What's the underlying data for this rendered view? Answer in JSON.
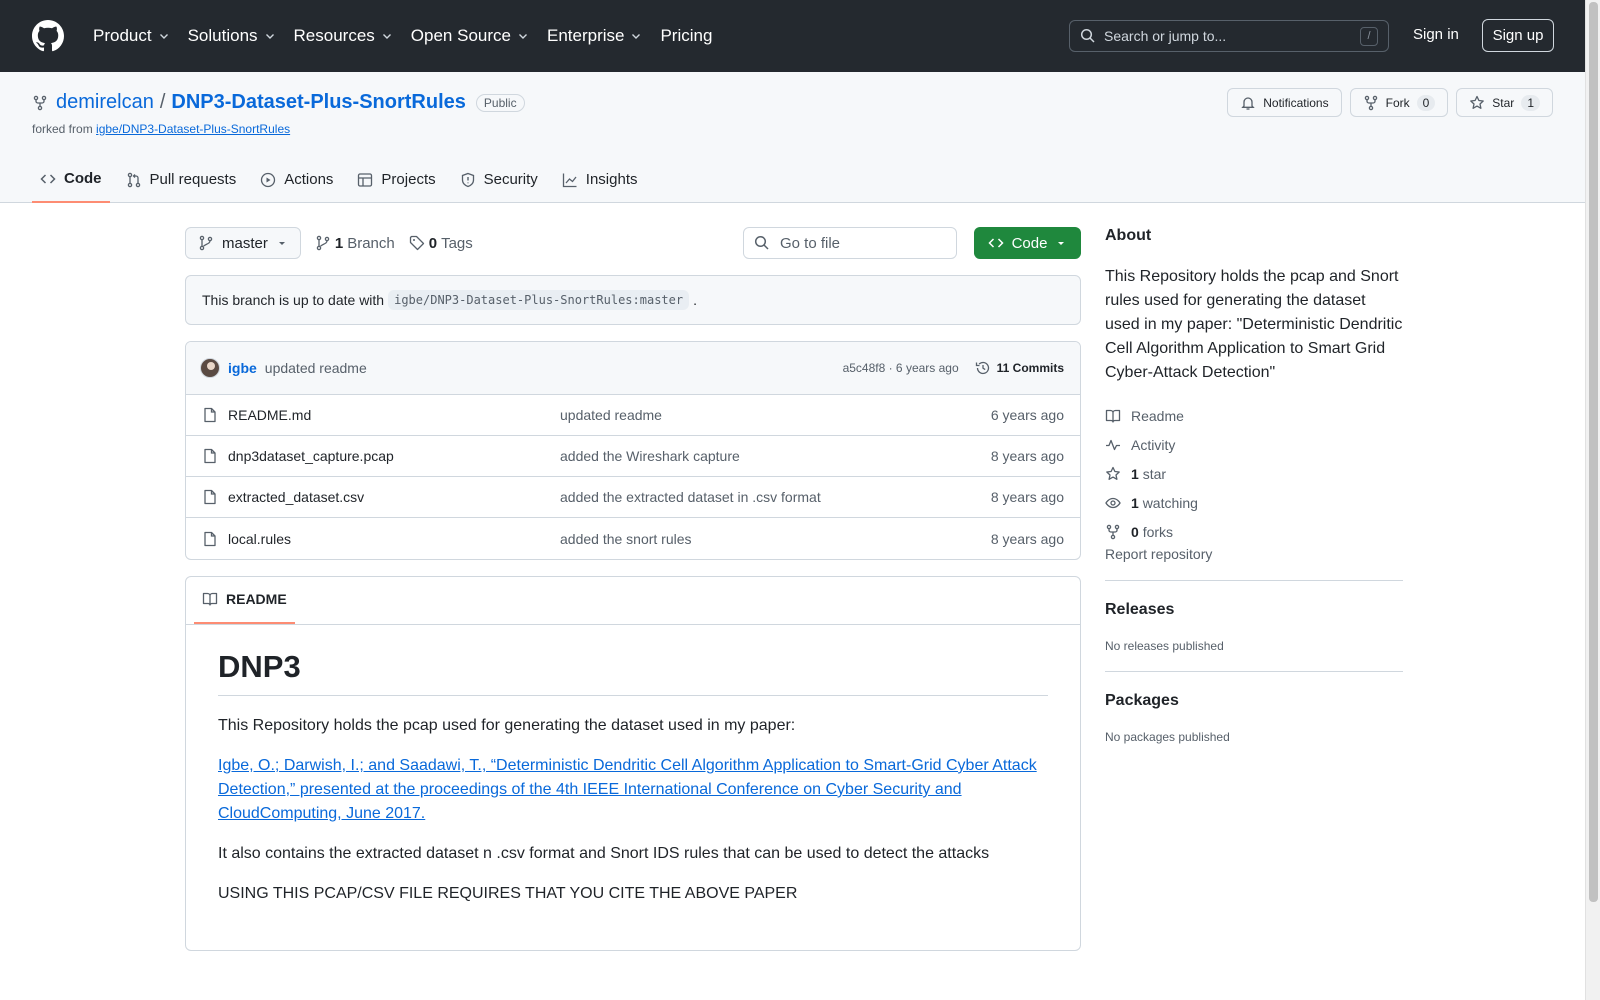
{
  "topnav": {
    "items": [
      "Product",
      "Solutions",
      "Resources",
      "Open Source",
      "Enterprise",
      "Pricing"
    ],
    "search_placeholder": "Search or jump to...",
    "search_shortcut": "/",
    "signin": "Sign in",
    "signup": "Sign up"
  },
  "repo": {
    "owner": "demirelcan",
    "separator": "/",
    "name": "DNP3-Dataset-Plus-SnortRules",
    "visibility": "Public",
    "forked_prefix": "forked from",
    "forked_from": "igbe/DNP3-Dataset-Plus-SnortRules",
    "notifications_label": "Notifications",
    "fork_label": "Fork",
    "fork_count": "0",
    "star_label": "Star",
    "star_count": "1"
  },
  "tabs": [
    "Code",
    "Pull requests",
    "Actions",
    "Projects",
    "Security",
    "Insights"
  ],
  "branchbar": {
    "branch": "master",
    "branch_count": "1",
    "branch_label": "Branch",
    "tag_count": "0",
    "tag_label": "Tags",
    "go_to_file": "Go to file",
    "code_button": "Code"
  },
  "uptodate": {
    "text": "This branch is up to date with",
    "ref": "igbe/DNP3-Dataset-Plus-SnortRules:master",
    "period": "."
  },
  "commit": {
    "author": "igbe",
    "message": "updated readme",
    "sha_age": "a5c48f8 · 6 years ago",
    "commits": "11 Commits"
  },
  "files": [
    {
      "name": "README.md",
      "message": "updated readme",
      "age": "6 years ago"
    },
    {
      "name": "dnp3dataset_capture.pcap",
      "message": "added the Wireshark capture",
      "age": "8 years ago"
    },
    {
      "name": "extracted_dataset.csv",
      "message": "added the extracted dataset in .csv format",
      "age": "8 years ago"
    },
    {
      "name": "local.rules",
      "message": "added the snort rules",
      "age": "8 years ago"
    }
  ],
  "readme": {
    "tab": "README",
    "heading": "DNP3",
    "p1": "This Repository holds the pcap used for generating the dataset used in my paper:",
    "citation": "Igbe, O.; Darwish, I.; and Saadawi, T., “Deterministic Dendritic Cell Algorithm Application to Smart-Grid Cyber Attack Detection,” presented at the proceedings of the 4th IEEE International Conference on Cyber Security and CloudComputing, June 2017.",
    "p2": "It also contains the extracted dataset n .csv format and Snort IDS rules that can be used to detect the attacks",
    "p3": "USING THIS PCAP/CSV FILE REQUIRES THAT YOU CITE THE ABOVE PAPER"
  },
  "about": {
    "title": "About",
    "description": "This Repository holds the pcap and Snort rules used for generating the dataset used in my paper: \"Deterministic Dendritic Cell Algorithm Application to Smart Grid Cyber-Attack Detection\"",
    "readme": "Readme",
    "activity": "Activity",
    "stars_count": "1",
    "stars_label": "star",
    "watching_count": "1",
    "watching_label": "watching",
    "forks_count": "0",
    "forks_label": "forks",
    "report": "Report repository"
  },
  "releases": {
    "title": "Releases",
    "empty": "No releases published"
  },
  "packages": {
    "title": "Packages",
    "empty": "No packages published"
  },
  "colors": {
    "header_bg": "#24292f",
    "accent": "#0969da",
    "code_button": "#1f883d",
    "tab_underline": "#fd8c73"
  }
}
